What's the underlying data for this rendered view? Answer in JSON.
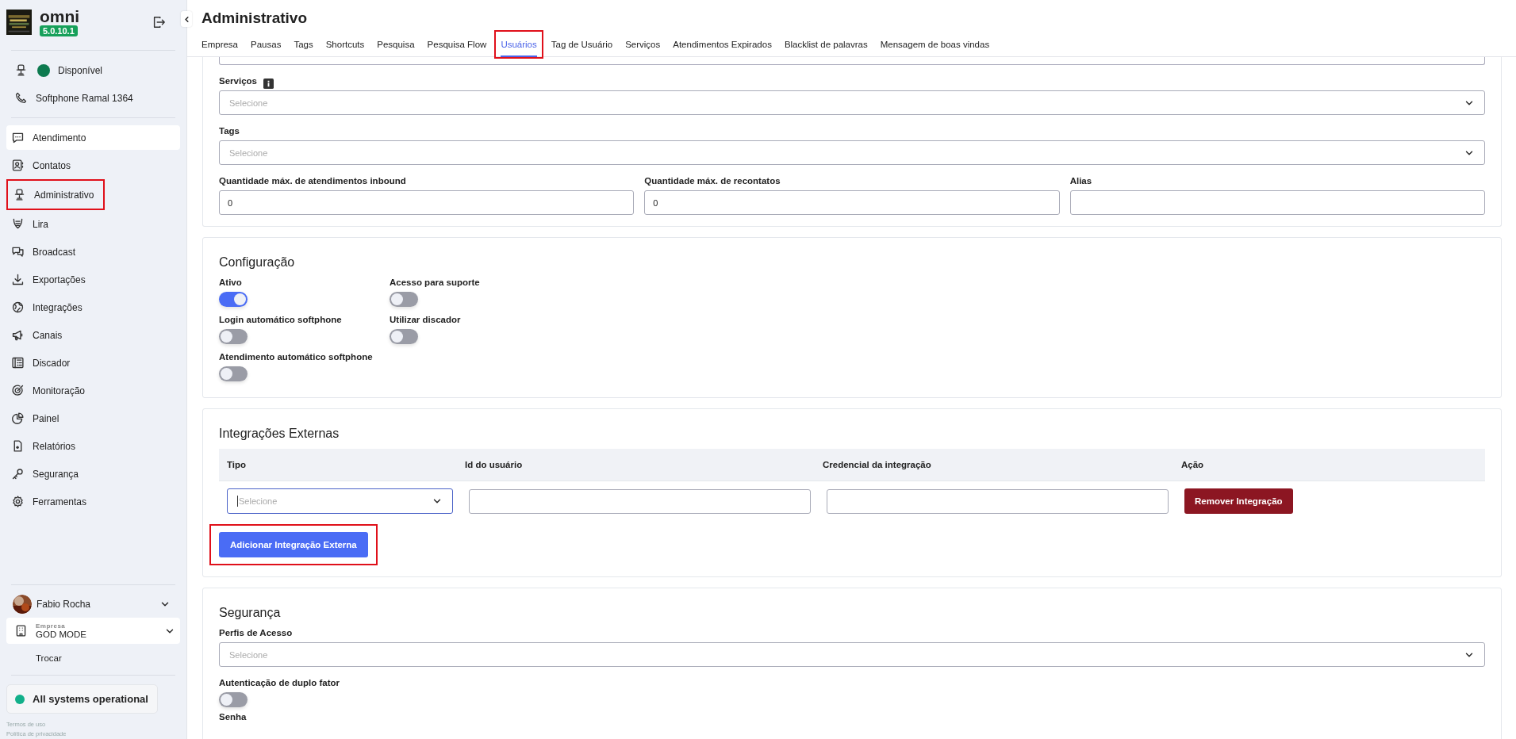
{
  "sidebar": {
    "brand": "omni",
    "version": "5.0.10.1",
    "status": {
      "label": "Disponível"
    },
    "softphone": "Softphone Ramal 1364",
    "nav": [
      {
        "label": "Atendimento",
        "selected": true,
        "highlighted": false
      },
      {
        "label": "Contatos",
        "selected": false,
        "highlighted": false
      },
      {
        "label": "Administrativo",
        "selected": false,
        "highlighted": true
      },
      {
        "label": "Lira",
        "selected": false,
        "highlighted": false
      },
      {
        "label": "Broadcast",
        "selected": false,
        "highlighted": false
      },
      {
        "label": "Exportações",
        "selected": false,
        "highlighted": false
      },
      {
        "label": "Integrações",
        "selected": false,
        "highlighted": false
      },
      {
        "label": "Canais",
        "selected": false,
        "highlighted": false
      },
      {
        "label": "Discador",
        "selected": false,
        "highlighted": false
      },
      {
        "label": "Monitoração",
        "selected": false,
        "highlighted": false
      },
      {
        "label": "Painel",
        "selected": false,
        "highlighted": false
      },
      {
        "label": "Relatórios",
        "selected": false,
        "highlighted": false
      },
      {
        "label": "Segurança",
        "selected": false,
        "highlighted": false
      },
      {
        "label": "Ferramentas",
        "selected": false,
        "highlighted": false
      }
    ],
    "user": "Fabio Rocha",
    "company": {
      "caption": "Empresa",
      "name": "GOD MODE"
    },
    "switch": "Trocar",
    "system_status": "All systems operational",
    "footer_links": [
      "Termos de uso",
      "Política de privacidade"
    ]
  },
  "page": {
    "title": "Administrativo",
    "tabs": [
      {
        "label": "Empresa",
        "selected": false,
        "highlighted": false
      },
      {
        "label": "Pausas",
        "selected": false,
        "highlighted": false
      },
      {
        "label": "Tags",
        "selected": false,
        "highlighted": false
      },
      {
        "label": "Shortcuts",
        "selected": false,
        "highlighted": false
      },
      {
        "label": "Pesquisa",
        "selected": false,
        "highlighted": false
      },
      {
        "label": "Pesquisa Flow",
        "selected": false,
        "highlighted": false
      },
      {
        "label": "Usuários",
        "selected": true,
        "highlighted": true
      },
      {
        "label": "Tag de Usuário",
        "selected": false,
        "highlighted": false
      },
      {
        "label": "Serviços",
        "selected": false,
        "highlighted": false
      },
      {
        "label": "Atendimentos Expirados",
        "selected": false,
        "highlighted": false
      },
      {
        "label": "Blacklist de palavras",
        "selected": false,
        "highlighted": false
      },
      {
        "label": "Mensagem de boas vindas",
        "selected": false,
        "highlighted": false
      }
    ]
  },
  "user_form": {
    "services": {
      "label": "Serviços",
      "placeholder": "Selecione"
    },
    "tags": {
      "label": "Tags",
      "placeholder": "Selecione"
    },
    "limits": [
      {
        "label": "Quantidade máx. de atendimentos inbound",
        "value": "0"
      },
      {
        "label": "Quantidade máx. de recontatos",
        "value": "0"
      },
      {
        "label": "Alias"
      }
    ]
  },
  "configuration": {
    "title": "Configuração",
    "toggles": [
      {
        "label": "Ativo",
        "on": true
      },
      {
        "label": "Acesso para suporte",
        "on": false
      },
      {
        "label": "Login automático softphone",
        "on": false
      },
      {
        "label": "Utilizar discador",
        "on": false
      },
      {
        "label": "Atendimento automático softphone",
        "on": false
      }
    ]
  },
  "external_integrations": {
    "title": "Integrações Externas",
    "columns": [
      "Tipo",
      "Id do usuário",
      "Credencial da integração",
      "Ação"
    ],
    "rows": [
      {
        "type_placeholder": "Selecione",
        "type_focused": true,
        "remove_button": "Remover Integração"
      }
    ],
    "add_button": {
      "label": "Adicionar Integração Externa",
      "highlighted": true
    }
  },
  "security": {
    "title": "Segurança",
    "profiles": {
      "label": "Perfis de Acesso",
      "placeholder": "Selecione"
    },
    "two_factor": {
      "label": "Autenticação de duplo fator",
      "on": false
    },
    "password_label": "Senha"
  }
}
